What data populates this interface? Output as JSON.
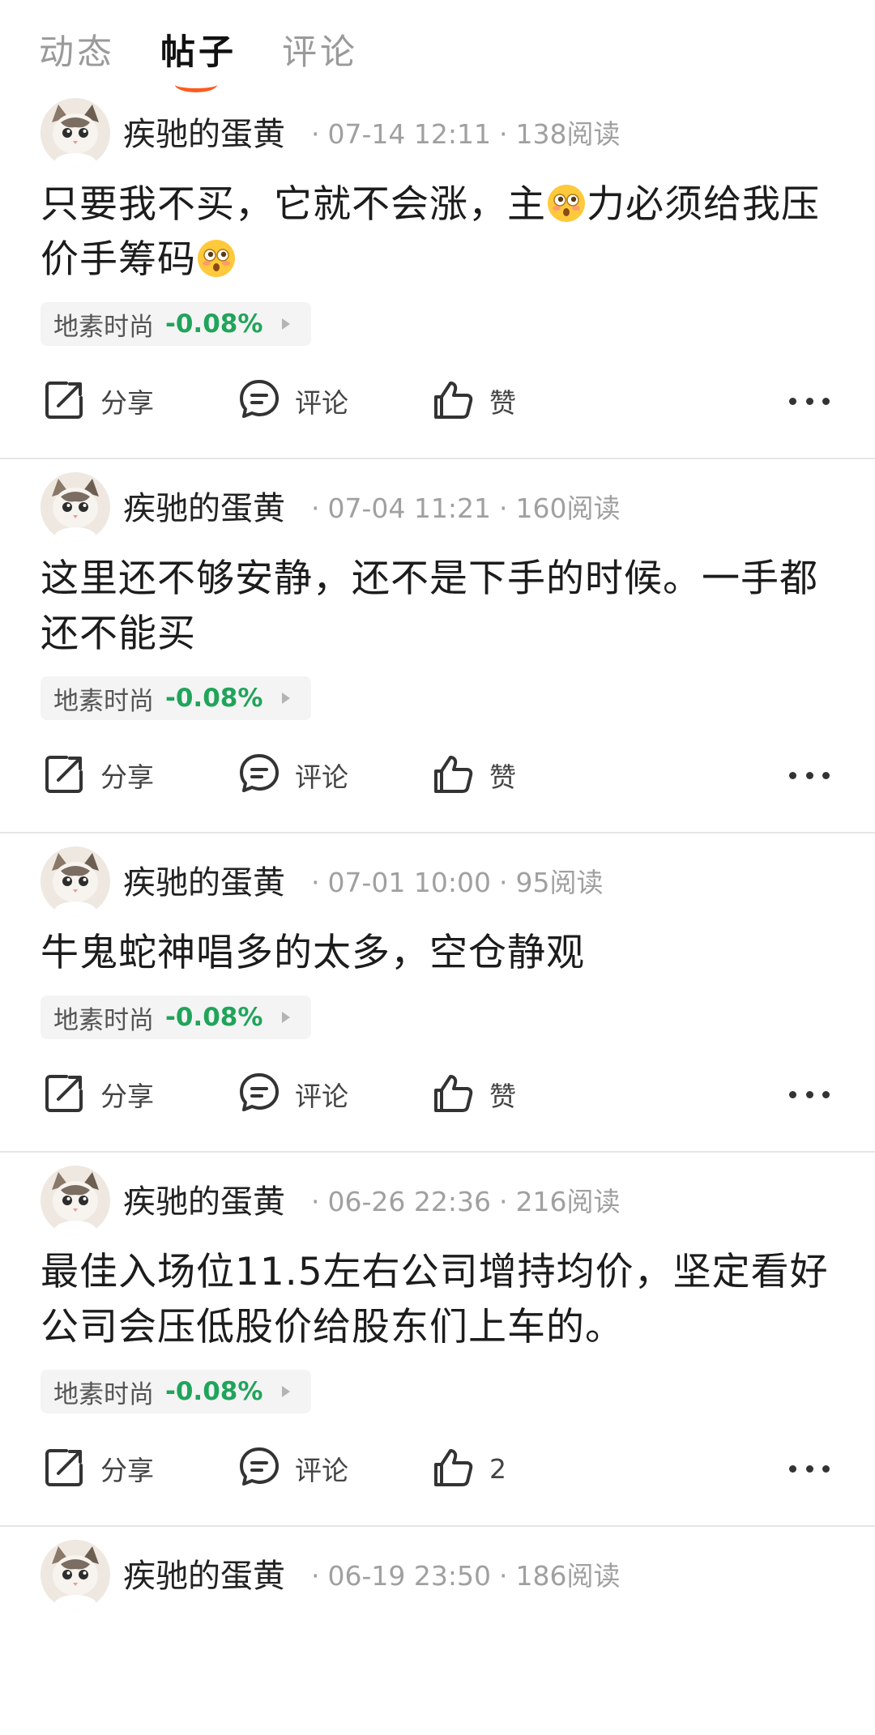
{
  "tabs": [
    {
      "label": "动态",
      "active": false
    },
    {
      "label": "帖子",
      "active": true
    },
    {
      "label": "评论",
      "active": false
    }
  ],
  "colors": {
    "accent": "#ff5a1f",
    "stock_down": "#20a45a"
  },
  "actions": {
    "share": "分享",
    "comment": "评论",
    "like": "赞"
  },
  "posts": [
    {
      "author": "疾驰的蛋黄",
      "date": "07-14 12:11",
      "reads": "138阅读",
      "content_parts": [
        "只要我不买，它就不会涨，主",
        "力必须给我压价手筹码",
        ""
      ],
      "stock": {
        "name": "地素时尚",
        "change": "-0.08%"
      },
      "like_label": "赞"
    },
    {
      "author": "疾驰的蛋黄",
      "date": "07-04 11:21",
      "reads": "160阅读",
      "content": "这里还不够安静，还不是下手的时候。一手都还不能买",
      "stock": {
        "name": "地素时尚",
        "change": "-0.08%"
      },
      "like_label": "赞"
    },
    {
      "author": "疾驰的蛋黄",
      "date": "07-01 10:00",
      "reads": "95阅读",
      "content": "牛鬼蛇神唱多的太多，空仓静观",
      "stock": {
        "name": "地素时尚",
        "change": "-0.08%"
      },
      "like_label": "赞"
    },
    {
      "author": "疾驰的蛋黄",
      "date": "06-26 22:36",
      "reads": "216阅读",
      "content": "最佳入场位11.5左右公司增持均价，坚定看好公司会压低股价给股东们上车的。",
      "stock": {
        "name": "地素时尚",
        "change": "-0.08%"
      },
      "like_label": "2"
    },
    {
      "author": "疾驰的蛋黄",
      "date": "06-19 23:50",
      "reads": "186阅读"
    }
  ]
}
